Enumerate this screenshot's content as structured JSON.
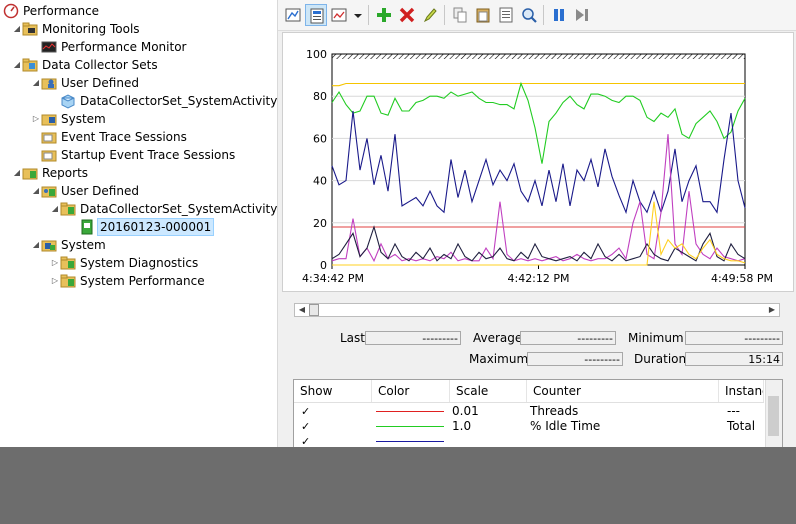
{
  "tree": [
    {
      "label": "Performance",
      "level": 0,
      "toggle": "",
      "icon": "performance-icon"
    },
    {
      "label": "Monitoring Tools",
      "level": 1,
      "toggle": "open",
      "icon": "folder-tools-icon"
    },
    {
      "label": "Performance Monitor",
      "level": 2,
      "toggle": "",
      "icon": "performance-monitor-icon"
    },
    {
      "label": "Data Collector Sets",
      "level": 1,
      "toggle": "open",
      "icon": "data-collector-icon"
    },
    {
      "label": "User Defined",
      "level": 2,
      "toggle": "open",
      "icon": "user-defined-icon"
    },
    {
      "label": "DataCollectorSet_SystemActivity",
      "level": 3,
      "toggle": "",
      "icon": "collector-set-icon"
    },
    {
      "label": "System",
      "level": 2,
      "toggle": "closed",
      "icon": "system-folder-icon"
    },
    {
      "label": "Event Trace Sessions",
      "level": 2,
      "toggle": "",
      "icon": "event-trace-icon"
    },
    {
      "label": "Startup Event Trace Sessions",
      "level": 2,
      "toggle": "",
      "icon": "event-trace-icon"
    },
    {
      "label": "Reports",
      "level": 1,
      "toggle": "open",
      "icon": "reports-icon"
    },
    {
      "label": "User Defined",
      "level": 2,
      "toggle": "open",
      "icon": "user-report-icon"
    },
    {
      "label": "DataCollectorSet_SystemActivity",
      "level": 3,
      "toggle": "open",
      "icon": "folder-green-icon"
    },
    {
      "label": "20160123-000001",
      "level": 4,
      "toggle": "",
      "icon": "report-file-icon",
      "selected": true
    },
    {
      "label": "System",
      "level": 2,
      "toggle": "open",
      "icon": "system-report-icon"
    },
    {
      "label": "System Diagnostics",
      "level": 3,
      "toggle": "closed",
      "icon": "folder-green-icon"
    },
    {
      "label": "System Performance",
      "level": 3,
      "toggle": "closed",
      "icon": "folder-green-icon"
    }
  ],
  "toolbar": [
    {
      "name": "view-current-activity-icon"
    },
    {
      "name": "view-log-data-icon",
      "active": true
    },
    {
      "name": "change-graph-type-icon"
    },
    {
      "name": "dropdown-arrow-icon"
    },
    {
      "name": "separator"
    },
    {
      "name": "add-counter-icon"
    },
    {
      "name": "delete-counter-icon"
    },
    {
      "name": "highlight-icon"
    },
    {
      "name": "separator"
    },
    {
      "name": "copy-properties-icon"
    },
    {
      "name": "paste-counter-list-icon"
    },
    {
      "name": "properties-icon"
    },
    {
      "name": "zoom-icon"
    },
    {
      "name": "separator"
    },
    {
      "name": "freeze-display-icon"
    },
    {
      "name": "update-data-icon"
    }
  ],
  "stats": {
    "last_label": "Last",
    "last_value": "---------",
    "average_label": "Average",
    "average_value": "---------",
    "minimum_label": "Minimum",
    "minimum_value": "---------",
    "maximum_label": "Maximum",
    "maximum_value": "---------",
    "duration_label": "Duration",
    "duration_value": "15:14"
  },
  "legend": {
    "columns": [
      "Show",
      "Color",
      "Scale",
      "Counter",
      "Instance"
    ],
    "rows": [
      {
        "show": "✓",
        "color": "#e02020",
        "scale": "0.01",
        "counter": "Threads",
        "instance": "---"
      },
      {
        "show": "✓",
        "color": "#22cc22",
        "scale": "1.0",
        "counter": "% Idle Time",
        "instance": "Total"
      },
      {
        "show": "✓",
        "color": "#1a1aa0",
        "scale": "",
        "counter": "",
        "instance": ""
      }
    ]
  },
  "chart_data": {
    "type": "line",
    "ylim": [
      0,
      100
    ],
    "yticks": [
      0,
      20,
      40,
      60,
      80,
      100
    ],
    "xticks": [
      "4:34:42 PM",
      "4:42:12 PM",
      "4:49:58 PM"
    ],
    "series": [
      {
        "color": "#f5c400",
        "values": [
          85,
          85,
          86,
          86,
          86,
          86,
          86,
          86,
          86,
          86,
          86,
          86,
          86,
          86,
          86,
          86,
          86,
          86,
          86,
          86,
          86,
          86,
          86,
          86,
          86,
          86,
          86,
          86,
          86,
          86,
          86,
          86,
          86,
          86,
          86,
          86,
          86,
          86,
          86,
          86,
          86,
          86,
          86,
          86,
          86,
          86,
          86,
          86,
          86,
          86,
          86,
          86,
          86,
          86,
          86,
          86,
          86,
          86,
          86,
          86
        ]
      },
      {
        "color": "#22cc22",
        "values": [
          77,
          82,
          76,
          72,
          73,
          80,
          80,
          72,
          71,
          79,
          73,
          73,
          77,
          78,
          80,
          80,
          79,
          82,
          80,
          81,
          82,
          79,
          77,
          77,
          76,
          76,
          74,
          86,
          78,
          65,
          48,
          68,
          72,
          77,
          80,
          76,
          74,
          81,
          81,
          80,
          78,
          77,
          80,
          80,
          78,
          70,
          68,
          72,
          70,
          74,
          62,
          60,
          67,
          70,
          73,
          68,
          60,
          63,
          73,
          79
        ]
      },
      {
        "color": "#e04040",
        "values": [
          18,
          18,
          18,
          18,
          18,
          18,
          18,
          18,
          18,
          18,
          18,
          18,
          18,
          18,
          18,
          18,
          18,
          18,
          18,
          18,
          18,
          18,
          18,
          18,
          18,
          18,
          18,
          18,
          18,
          18,
          18,
          18,
          18,
          18,
          18,
          18,
          18,
          18,
          18,
          18,
          18,
          18,
          18,
          18,
          18,
          18,
          18,
          18,
          18,
          18,
          18,
          18,
          18,
          18,
          18,
          18,
          18,
          18,
          18,
          18
        ]
      },
      {
        "color": "#1a1a8a",
        "values": [
          47,
          38,
          40,
          73,
          45,
          60,
          38,
          52,
          35,
          62,
          28,
          30,
          32,
          28,
          35,
          28,
          25,
          50,
          32,
          45,
          30,
          40,
          50,
          38,
          45,
          40,
          48,
          35,
          30,
          40,
          28,
          45,
          30,
          48,
          28,
          45,
          40,
          50,
          37,
          55,
          42,
          33,
          25,
          40,
          30,
          25,
          35,
          25,
          35,
          55,
          30,
          40,
          47,
          30,
          30,
          25,
          50,
          72,
          40,
          27
        ]
      },
      {
        "color": "#c040c0",
        "values": [
          2,
          3,
          3,
          22,
          4,
          8,
          2,
          10,
          3,
          5,
          2,
          3,
          2,
          3,
          2,
          4,
          3,
          6,
          2,
          3,
          2,
          2,
          8,
          3,
          30,
          5,
          2,
          3,
          2,
          3,
          2,
          3,
          4,
          2,
          3,
          5,
          3,
          2,
          3,
          3,
          5,
          8,
          3,
          20,
          30,
          5,
          3,
          25,
          62,
          10,
          5,
          35,
          10,
          5,
          3,
          8,
          4,
          3,
          2,
          3
        ]
      },
      {
        "color": "#202040",
        "values": [
          3,
          5,
          10,
          15,
          4,
          8,
          18,
          6,
          3,
          10,
          4,
          2,
          6,
          3,
          8,
          2,
          5,
          3,
          10,
          4,
          2,
          6,
          3,
          4,
          8,
          3,
          2,
          6,
          3,
          10,
          4,
          3,
          2,
          3,
          4,
          2,
          6,
          3,
          10,
          4,
          2,
          5,
          2,
          3,
          4,
          10,
          5,
          3,
          2,
          8,
          6,
          4,
          2,
          10,
          15,
          4,
          2,
          10,
          5,
          3
        ]
      },
      {
        "color": "#ffd020",
        "values": [
          0,
          0,
          0,
          0,
          0,
          0,
          0,
          0,
          0,
          0,
          0,
          0,
          0,
          0,
          0,
          0,
          0,
          0,
          0,
          0,
          0,
          0,
          0,
          0,
          0,
          0,
          0,
          0,
          0,
          0,
          0,
          0,
          0,
          0,
          0,
          0,
          0,
          0,
          0,
          0,
          0,
          0,
          0,
          0,
          0,
          0,
          30,
          5,
          12,
          8,
          10,
          5,
          3,
          8,
          12,
          5,
          3,
          2,
          2,
          1
        ]
      }
    ]
  }
}
